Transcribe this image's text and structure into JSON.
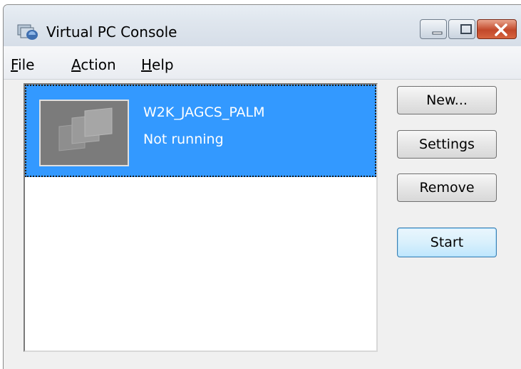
{
  "window": {
    "title": "Virtual PC Console"
  },
  "menu": {
    "file": {
      "accel": "F",
      "rest": "ile"
    },
    "action": {
      "accel": "A",
      "rest": "ction"
    },
    "help": {
      "accel": "H",
      "rest": "elp"
    }
  },
  "vm_list": [
    {
      "name": "W2K_JAGCS_PALM",
      "status": "Not running",
      "selected": true
    }
  ],
  "buttons": {
    "new": "New...",
    "settings": "Settings",
    "remove": "Remove",
    "start": "Start"
  },
  "colors": {
    "selection": "#3399ff",
    "close_button": "#c2482a",
    "window_bg": "#f0f0f0"
  }
}
